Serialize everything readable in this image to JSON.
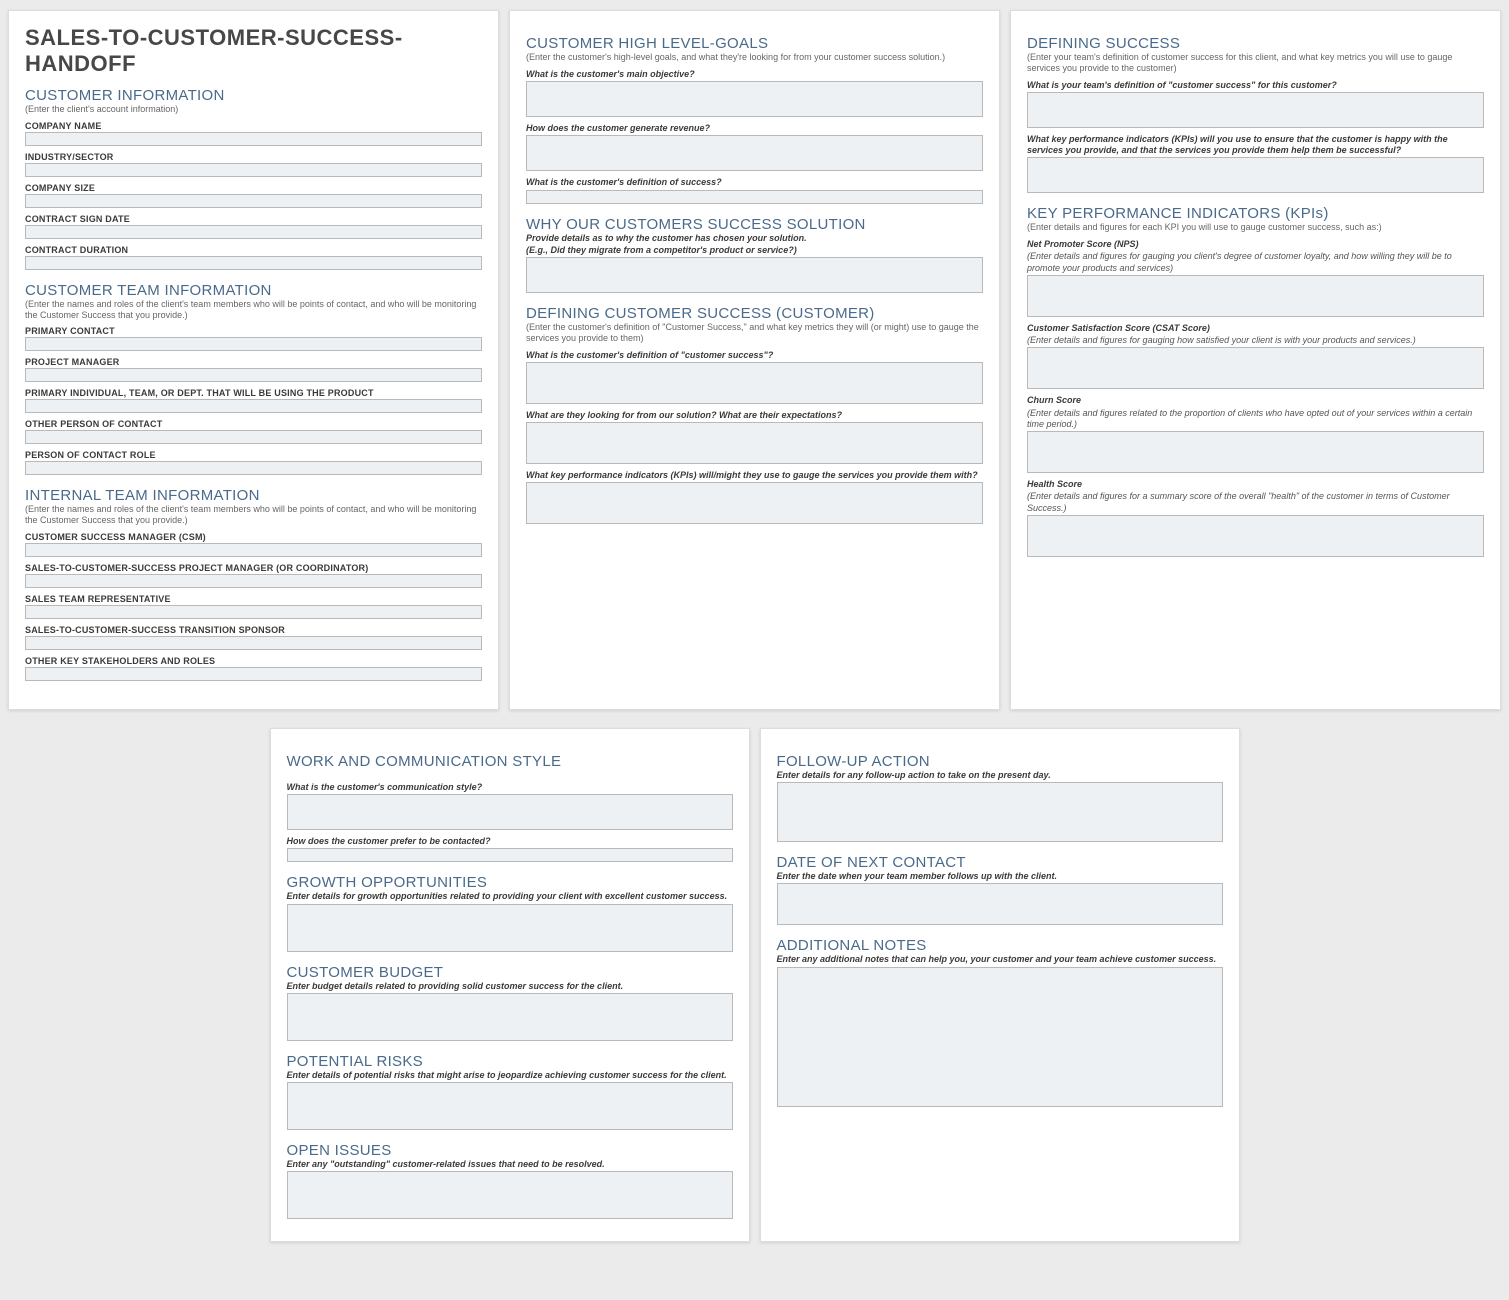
{
  "docTitle": "SALES-TO-CUSTOMER-SUCCESS-HANDOFF",
  "p1": {
    "custInfo": {
      "head": "CUSTOMER INFORMATION",
      "sub": "(Enter the client's account information)"
    },
    "f": {
      "company": "COMPANY NAME",
      "industry": "INDUSTRY/SECTOR",
      "size": "COMPANY SIZE",
      "signDate": "CONTRACT SIGN DATE",
      "duration": "CONTRACT DURATION"
    },
    "teamInfo": {
      "head": "CUSTOMER TEAM INFORMATION",
      "sub": "(Enter the names and roles of the client's team members who will be points of contact, and who will be monitoring the Customer Success that you provide.)"
    },
    "tf": {
      "primary": "PRIMARY CONTACT",
      "pm": "PROJECT MANAGER",
      "primaryInd": "PRIMARY INDIVIDUAL, TEAM, OR DEPT. THAT WILL BE USING THE PRODUCT",
      "other": "OTHER PERSON OF CONTACT",
      "role": "PERSON OF CONTACT ROLE"
    },
    "intTeam": {
      "head": "INTERNAL TEAM INFORMATION",
      "sub": "(Enter the names and roles of the client's team members who will be points of contact, and who will be monitoring the Customer Success that you provide.)"
    },
    "itf": {
      "csm": "CUSTOMER SUCCESS MANAGER (CSM)",
      "pmc": "SALES-TO-CUSTOMER-SUCCESS PROJECT MANAGER (OR COORDINATOR)",
      "rep": "SALES TEAM REPRESENTATIVE",
      "sponsor": "SALES-TO-CUSTOMER-SUCCESS TRANSITION SPONSOR",
      "stake": "OTHER KEY STAKEHOLDERS AND ROLES"
    }
  },
  "p2": {
    "goals": {
      "head": "CUSTOMER HIGH LEVEL-GOALS",
      "sub": "(Enter the customer's high-level goals, and what they're looking for from your customer success solution.)"
    },
    "q": {
      "obj": "What is the customer's main objective?",
      "rev": "How does the customer generate revenue?",
      "defSuccess": "What is the customer's definition of success?"
    },
    "why": {
      "head": "WHY OUR CUSTOMERS SUCCESS SOLUTION",
      "prompt": "Provide details as to why the customer has chosen your solution.",
      "prompt2": "(E.g., Did they migrate from a competitor's product or service?)"
    },
    "defCust": {
      "head": "DEFINING CUSTOMER SUCCESS (CUSTOMER)",
      "sub": "(Enter the customer's definition of \"Customer Success,\" and what key metrics they will (or might) use to gauge the services you provide to them)"
    },
    "dc": {
      "q1": "What is the customer's definition of \"customer success\"?",
      "q2": "What are they looking for from our solution? What are their expectations?",
      "q3": "What key performance indicators (KPIs) will/might they use to gauge the services you provide them with?"
    }
  },
  "p3": {
    "def": {
      "head": "DEFINING SUCCESS",
      "sub": "(Enter your team's definition of customer success for this client, and what key metrics you will use to gauge services you provide to the customer)"
    },
    "dq": {
      "q1": "What is your team's definition of \"customer success\" for this customer?",
      "q2": "What key performance indicators (KPIs) will you use to ensure that the customer is happy with the services you provide, and that the services you provide them help them be successful?"
    },
    "kpi": {
      "head": "KEY PERFORMANCE INDICATORS (KPIs)",
      "sub": "(Enter details and figures for each KPI you will use to gauge customer success, such as:)"
    },
    "k": {
      "nps": {
        "label": "Net Promoter Score (NPS)",
        "note": "(Enter details and figures for gauging you client's degree of customer loyalty, and how willing they will be to promote your products and services)"
      },
      "csat": {
        "label": "Customer Satisfaction Score (CSAT Score)",
        "note": "(Enter details and figures for gauging how satisfied your client is with your products and services.)"
      },
      "churn": {
        "label": "Churn Score",
        "note": "(Enter details and figures related to the proportion of clients who have opted out of your services within a certain time period.)"
      },
      "health": {
        "label": "Health Score",
        "note": "(Enter details and figures for a summary score of the overall \"health\" of the customer in terms of  Customer Success.)"
      }
    }
  },
  "p4": {
    "work": {
      "head": "WORK AND COMMUNICATION STYLE",
      "q1": "What is the customer's communication style?",
      "q2": "How does the customer prefer to be contacted?"
    },
    "growth": {
      "head": "GROWTH OPPORTUNITIES",
      "prompt": "Enter details for growth opportunities related to providing your client with excellent customer success."
    },
    "budget": {
      "head": "CUSTOMER BUDGET",
      "prompt": "Enter budget details related to providing solid customer success for the client."
    },
    "risks": {
      "head": "POTENTIAL RISKS",
      "prompt": "Enter details of potential risks that might arise to jeopardize achieving customer success for the client."
    },
    "open": {
      "head": "OPEN ISSUES",
      "prompt": "Enter any \"outstanding\" customer-related issues that need to be resolved."
    }
  },
  "p5": {
    "follow": {
      "head": "FOLLOW-UP ACTION",
      "prompt": "Enter details for any follow-up action to take on the present day."
    },
    "next": {
      "head": "DATE OF NEXT CONTACT",
      "prompt": "Enter the date when your team member follows up with the client."
    },
    "notes": {
      "head": "ADDITIONAL NOTES",
      "prompt": "Enter any additional notes that can help you, your customer and your team achieve customer success."
    }
  }
}
